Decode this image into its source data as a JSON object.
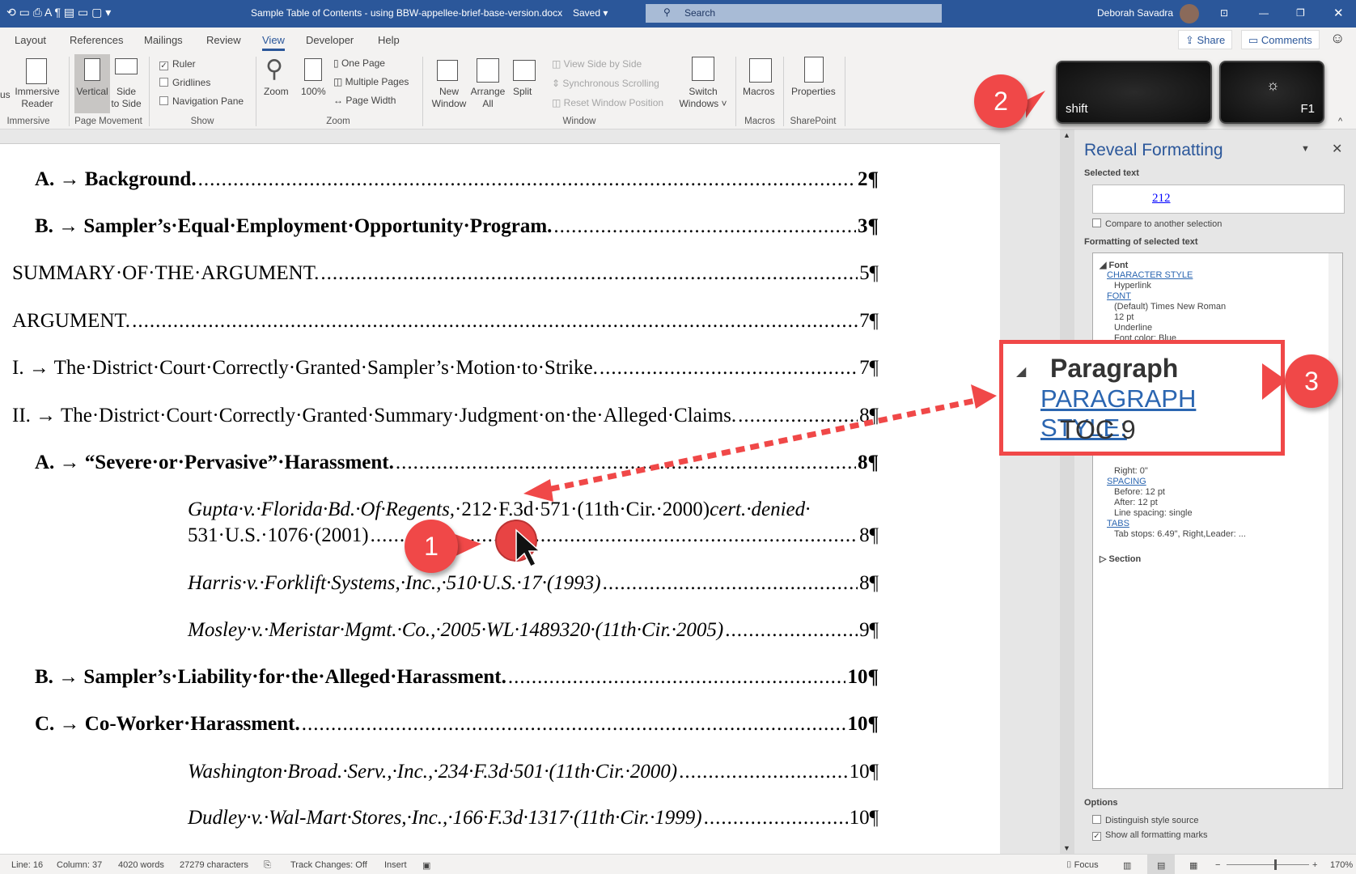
{
  "titlebar": {
    "doc_title": "Sample Table of Contents - using BBW-appellee-brief-base-version.docx",
    "saved": "Saved ▾",
    "search_placeholder": "Search",
    "user": "Deborah Savadra"
  },
  "tabs": [
    {
      "label": "Layout"
    },
    {
      "label": "References"
    },
    {
      "label": "Mailings"
    },
    {
      "label": "Review"
    },
    {
      "label": "View",
      "active": true
    },
    {
      "label": "Developer"
    },
    {
      "label": "Help"
    }
  ],
  "share_label": "Share",
  "comments_label": "Comments",
  "ribbon": {
    "immersive": {
      "focus": "us",
      "reader": "Immersive\nReader",
      "group": "Immersive"
    },
    "page_movement": {
      "vertical": "Vertical",
      "side": "Side\nto Side",
      "group": "Page Movement"
    },
    "show": {
      "ruler": "Ruler",
      "ruler_checked": true,
      "gridlines": "Gridlines",
      "gridlines_checked": false,
      "nav": "Navigation Pane",
      "nav_checked": false,
      "group": "Show"
    },
    "zoom": {
      "zoom": "Zoom",
      "hundred": "100%",
      "one_page": "One Page",
      "multiple": "Multiple Pages",
      "width": "Page Width",
      "group": "Zoom"
    },
    "window": {
      "new": "New\nWindow",
      "arrange": "Arrange\nAll",
      "split": "Split",
      "side_by_side": "View Side by Side",
      "sync": "Synchronous Scrolling",
      "reset": "Reset Window Position",
      "switch": "Switch\nWindows ˅",
      "group": "Window"
    },
    "macros": {
      "label": "Macros",
      "group": "Macros"
    },
    "sharepoint": {
      "label": "Properties",
      "group": "SharePoint"
    }
  },
  "keys": {
    "shift": "shift",
    "f1": "F1"
  },
  "callouts": [
    "1",
    "2",
    "3"
  ],
  "toc": [
    {
      "label": "A. → Background.",
      "page": "2¶",
      "style": "b",
      "level": 1
    },
    {
      "label": "B. → Sampler’s·Equal·Employment·Opportunity·Program.",
      "page": "3¶",
      "style": "b",
      "level": 1
    },
    {
      "label": "SUMMARY·OF·THE·ARGUMENT.",
      "page": "5¶",
      "style": "",
      "level": 0
    },
    {
      "label": "ARGUMENT.",
      "page": "7¶",
      "style": "",
      "level": 0
    },
    {
      "label": "I. → The·District·Court·Correctly·Granted·Sampler’s·Motion·to·Strike.",
      "page": "7¶",
      "style": "",
      "level": 0
    },
    {
      "label": "II. → The·District·Court·Correctly·Granted·Summary·Judgment·on·the·Alleged·Claims.",
      "page": "8¶",
      "style": "",
      "level": 0
    },
    {
      "label": "A. → “Severe·or·Pervasive”·Harassment.",
      "page": "8¶",
      "style": "b",
      "level": 1
    },
    {
      "label": "531·U.S.·1076·(2001)",
      "page": "8¶",
      "style": "",
      "level": 2
    },
    {
      "label": "Harris·v.·Forklift·Systems,·Inc.,·510·U.S.·17·(1993)",
      "page": "8¶",
      "style": "",
      "level": 2
    },
    {
      "label": "Mosley·v.·Meristar·Mgmt.·Co.,·2005·WL·1489320·(11th·Cir.·2005)",
      "page": "9¶",
      "style": "",
      "level": 2
    },
    {
      "label": "B. → Sampler’s·Liability·for·the·Alleged·Harassment.",
      "page": "10¶",
      "style": "b",
      "level": 1
    },
    {
      "label": "C. → Co-Worker·Harassment.",
      "page": "10¶",
      "style": "b",
      "level": 1
    },
    {
      "label": "Washington·Broad.·Serv.,·Inc.,·234·F.3d·501·(11th·Cir.·2000)",
      "page": "10¶",
      "style": "",
      "level": 2
    },
    {
      "label": "Dudley·v.·Wal-Mart·Stores,·Inc.,·166·F.3d·1317·(11th·Cir.·1999)",
      "page": "10¶",
      "style": "",
      "level": 2
    }
  ],
  "gupta_first_line": {
    "case": "Gupta·v.·Florida·Bd.·Of·Regents,",
    "cite": "·212·F.3d·571·(11th·Cir.·2000)",
    "tail": "cert.·denied·"
  },
  "pane": {
    "title": "Reveal Formatting",
    "selected_text_label": "Selected text",
    "selected_text": "212 ",
    "compare": "Compare to another selection",
    "formatting_label": "Formatting of selected text",
    "font_head": "Font",
    "char_style": "CHARACTER STYLE",
    "hyperlink": "Hyperlink",
    "font_link": "FONT",
    "font_name": "(Default) Times New Roman",
    "size": "12 pt",
    "underline": "Underline",
    "color": "Font color: Blue",
    "para_head": "Paragraph",
    "para_style": "PARAGRAPH STYLE:",
    "toc": "TOC 9",
    "right": "Right:  0\"",
    "spacing": "SPACING",
    "before": "Before:  12 pt",
    "after": "After:  12 pt",
    "line": "Line spacing:  single",
    "tabs": "TABS",
    "tab_stops": "Tab stops:  6.49\", Right,Leader: ...",
    "section": "Section",
    "options": "Options",
    "distinguish": "Distinguish style source",
    "distinguish_checked": false,
    "show_marks": "Show all formatting marks",
    "show_marks_checked": true
  },
  "status": {
    "line": "Line: 16",
    "column": "Column: 37",
    "words": "4020 words",
    "chars": "27279 characters",
    "track": "Track Changes: Off",
    "insert": "Insert",
    "focus": "Focus",
    "zoom": "170%",
    "zoom_percent": 170
  },
  "colors": {
    "brand": "#2b579a",
    "callout": "#f04848",
    "link": "#2b66b1"
  }
}
